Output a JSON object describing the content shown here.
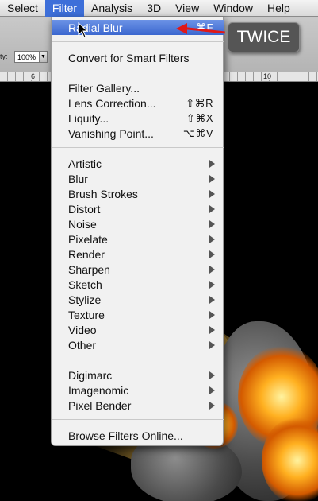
{
  "menubar": {
    "items": [
      {
        "label": "Select",
        "active": false
      },
      {
        "label": "Filter",
        "active": true
      },
      {
        "label": "Analysis",
        "active": false
      },
      {
        "label": "3D",
        "active": false
      },
      {
        "label": "View",
        "active": false
      },
      {
        "label": "Window",
        "active": false
      },
      {
        "label": "Help",
        "active": false
      }
    ]
  },
  "options": {
    "opacity_label": "ty:",
    "opacity_value": "100%",
    "dropdown_arrow": "▼"
  },
  "ruler": {
    "marks": [
      "6",
      "10"
    ]
  },
  "filter_menu": {
    "last_filter": {
      "label": "Radial Blur",
      "shortcut": "⌘F"
    },
    "convert": {
      "label": "Convert for Smart Filters"
    },
    "gallery_group": [
      {
        "label": "Filter Gallery...",
        "shortcut": ""
      },
      {
        "label": "Lens Correction...",
        "shortcut": "⇧⌘R"
      },
      {
        "label": "Liquify...",
        "shortcut": "⇧⌘X"
      },
      {
        "label": "Vanishing Point...",
        "shortcut": "⌥⌘V"
      }
    ],
    "submenus": [
      "Artistic",
      "Blur",
      "Brush Strokes",
      "Distort",
      "Noise",
      "Pixelate",
      "Render",
      "Sharpen",
      "Sketch",
      "Stylize",
      "Texture",
      "Video",
      "Other"
    ],
    "plugins": [
      "Digimarc",
      "Imagenomic",
      "Pixel Bender"
    ],
    "browse": {
      "label": "Browse Filters Online..."
    }
  },
  "annotation": {
    "callout_text": "TWICE",
    "arrow_color": "#e01818"
  },
  "colors": {
    "menu_highlight": "#3b67cf",
    "menu_bg": "#f1f1f1",
    "canvas_bg": "#000000"
  }
}
